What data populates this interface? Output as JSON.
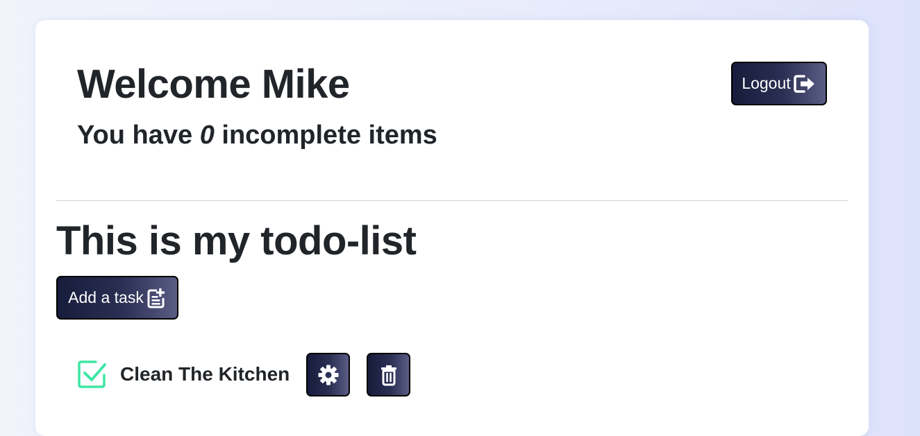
{
  "header": {
    "welcome_title": "Welcome Mike",
    "subtitle_prefix": "You have ",
    "incomplete_count": "0",
    "subtitle_suffix": " incomplete items",
    "logout_label": "Logout",
    "logout_icon": "logout-icon"
  },
  "todo_section": {
    "title": "This is my todo-list",
    "add_label": "Add a task",
    "add_icon": "add-task-icon"
  },
  "tasks": [
    {
      "title": "Clean The Kitchen",
      "completed": true,
      "status_icon": "checked-box-icon",
      "settings_icon": "gear-icon",
      "delete_icon": "trash-icon"
    }
  ],
  "colors": {
    "check_accent": "#3ee6a4",
    "button_dark": "#171c3c",
    "button_light": "#5a5c84",
    "text": "#212529"
  }
}
